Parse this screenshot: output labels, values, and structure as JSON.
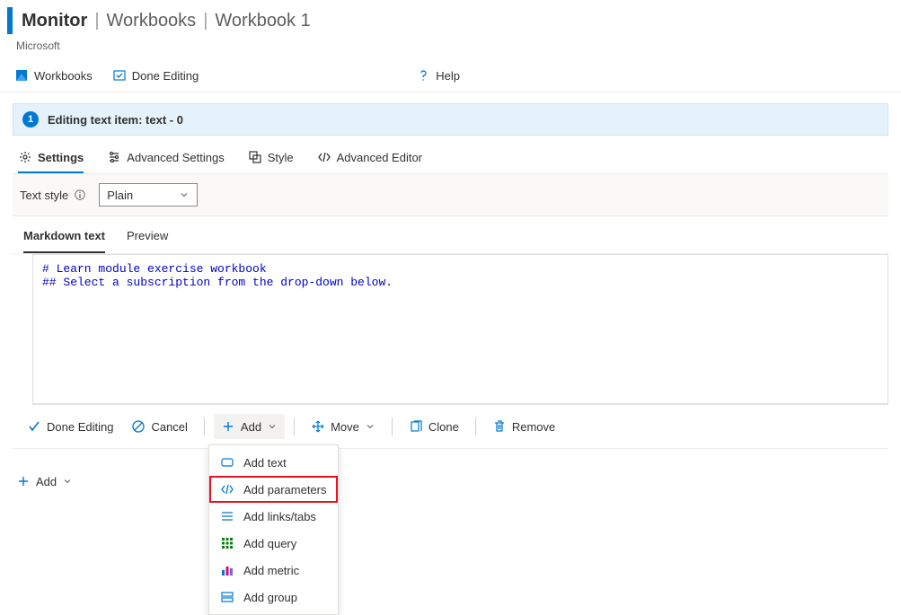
{
  "header": {
    "title": "Monitor",
    "crumb1": "Workbooks",
    "crumb2": "Workbook 1",
    "org": "Microsoft"
  },
  "toolbar": {
    "workbooks": "Workbooks",
    "done_editing": "Done Editing",
    "help": "Help"
  },
  "editing": {
    "badge": "1",
    "title": "Editing text item: text - 0"
  },
  "tabs1": {
    "settings": "Settings",
    "advanced_settings": "Advanced Settings",
    "style": "Style",
    "advanced_editor": "Advanced Editor"
  },
  "style_row": {
    "label": "Text style",
    "select_value": "Plain"
  },
  "tabs2": {
    "markdown": "Markdown text",
    "preview": "Preview"
  },
  "editor": {
    "content": "# Learn module exercise workbook\n## Select a subscription from the drop-down below."
  },
  "cmdbar": {
    "done_editing": "Done Editing",
    "cancel": "Cancel",
    "add": "Add",
    "move": "Move",
    "clone": "Clone",
    "remove": "Remove"
  },
  "dropdown": {
    "add_text": "Add text",
    "add_parameters": "Add parameters",
    "add_links_tabs": "Add links/tabs",
    "add_query": "Add query",
    "add_metric": "Add metric",
    "add_group": "Add group"
  },
  "footer": {
    "add": "Add"
  }
}
